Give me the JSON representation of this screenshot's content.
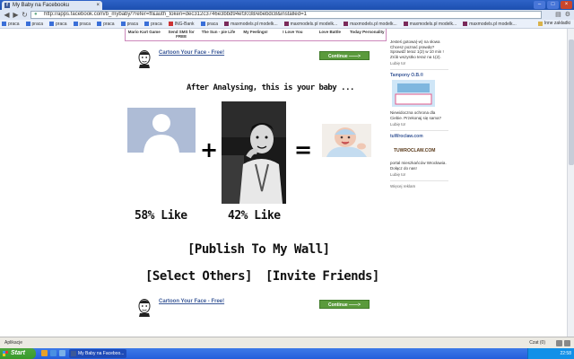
{
  "browser": {
    "tab_title": "My Baby na Facebooku",
    "tab_close": "×",
    "url": "http://apps.facebook.com/b_mybaby/?refer=ff&auth_token=dec312c3746e3bbd94ef3038/ebebdc8&installed=1",
    "nav": {
      "back": "◀",
      "forward": "▶",
      "reload": "↻"
    },
    "window_buttons": {
      "minimize": "–",
      "maximize": "□",
      "close": "×"
    }
  },
  "bookmarks": {
    "items": [
      "praca",
      "praca",
      "praca",
      "praca",
      "praca",
      "praca",
      "praca",
      "ING-Bank",
      "praca",
      "maxmodels.pl modelk...",
      "maxmodels.pl modelk...",
      "maxmodels.pl modelk...",
      "maxmodels.pl modelk...",
      "maxmodels.pl modelk..."
    ],
    "other": "Inne zakładki"
  },
  "apps_row": [
    "Mario Kart Game",
    "Send SMS for FREE",
    "The Sun - pie Life",
    "My Feelings!",
    "I Love You",
    "Love Battle",
    "Today Personality"
  ],
  "main": {
    "cartoon_link": "Cartoon Your Face - Free!",
    "continue_label": "Continue ——>",
    "analysing_text": "After Analysing, this is your baby ...",
    "plus": "+",
    "equals": "=",
    "left_pct": "58% Like",
    "right_pct": "42% Like",
    "publish": "[Publish To My Wall]",
    "select_others": "[Select Others]",
    "invite_friends": "[Invite Friends]"
  },
  "sidebar": {
    "ad1_text": "Jesteś gotowa(-w) na słowa Chcesz poznać prawdę? Sprawdź teraz 1(2) w 10 min ! Zrób wszystko teraz na 1(2).",
    "like": "Lubię to!",
    "ad2_title": "Tampony O.B.®",
    "ad2_text": "Niewidoczna ochrona dla Ciebie. Przekonaj się sama?",
    "ad3_title": "tuWroclaw.com",
    "ad3_logo": "TUWROCLAW.COM",
    "ad3_text": "portal mieszkańców Wrocławia. Dołącz do nas!",
    "more": "Więcej reklam"
  },
  "statusbar": {
    "apps": "Aplikacje",
    "chat": "Czat (0)"
  },
  "taskbar": {
    "start": "Start",
    "task": "My Baby na Faceboo...",
    "clock": "22:58"
  }
}
